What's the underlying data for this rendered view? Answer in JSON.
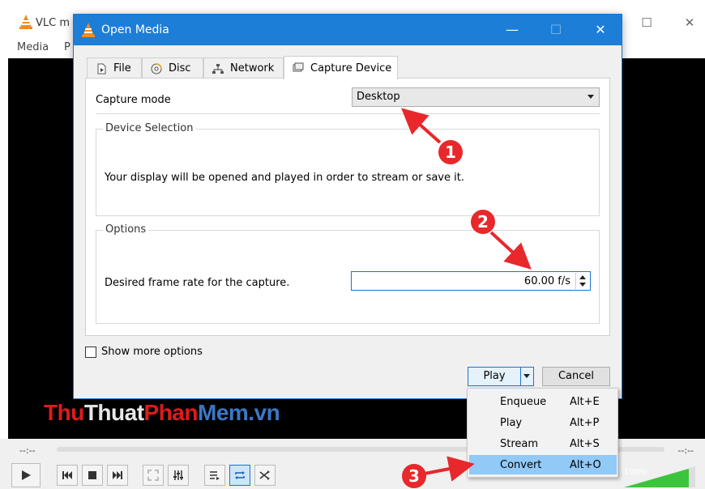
{
  "vlc": {
    "title": "VLC m",
    "menu": [
      "Media",
      "P"
    ],
    "time_left": "--:--",
    "time_right": "--:--",
    "volume": "100%"
  },
  "watermark": {
    "part1": "Thu",
    "part2": "Thuat",
    "part3": "Phan",
    "part4": "Mem.vn"
  },
  "dialog": {
    "title": "Open Media",
    "tabs": [
      {
        "label": "File",
        "icon": "file-icon"
      },
      {
        "label": "Disc",
        "icon": "disc-icon"
      },
      {
        "label": "Network",
        "icon": "network-icon"
      },
      {
        "label": "Capture Device",
        "icon": "capture-device-icon"
      }
    ],
    "active_tab": "Capture Device",
    "capture_mode_label": "Capture mode",
    "capture_mode_value": "Desktop",
    "device_selection": {
      "title": "Device Selection",
      "text": "Your display will be opened and played in order to stream or save it."
    },
    "options": {
      "title": "Options",
      "frame_rate_label": "Desired frame rate for the capture.",
      "frame_rate_value": "60.00 f/s"
    },
    "show_more_options": "Show more options",
    "show_more_checked": false,
    "play_label": "Play",
    "cancel_label": "Cancel"
  },
  "play_menu": {
    "items": [
      {
        "label": "Enqueue",
        "shortcut": "Alt+E"
      },
      {
        "label": "Play",
        "shortcut": "Alt+P"
      },
      {
        "label": "Stream",
        "shortcut": "Alt+S"
      },
      {
        "label": "Convert",
        "shortcut": "Alt+O",
        "highlighted": true
      }
    ]
  },
  "annotations": {
    "step1": "1",
    "step2": "2",
    "step3": "3",
    "color": "#e8282b"
  },
  "colors": {
    "accent": "#1c7ed6",
    "highlight": "#91c9f7"
  }
}
